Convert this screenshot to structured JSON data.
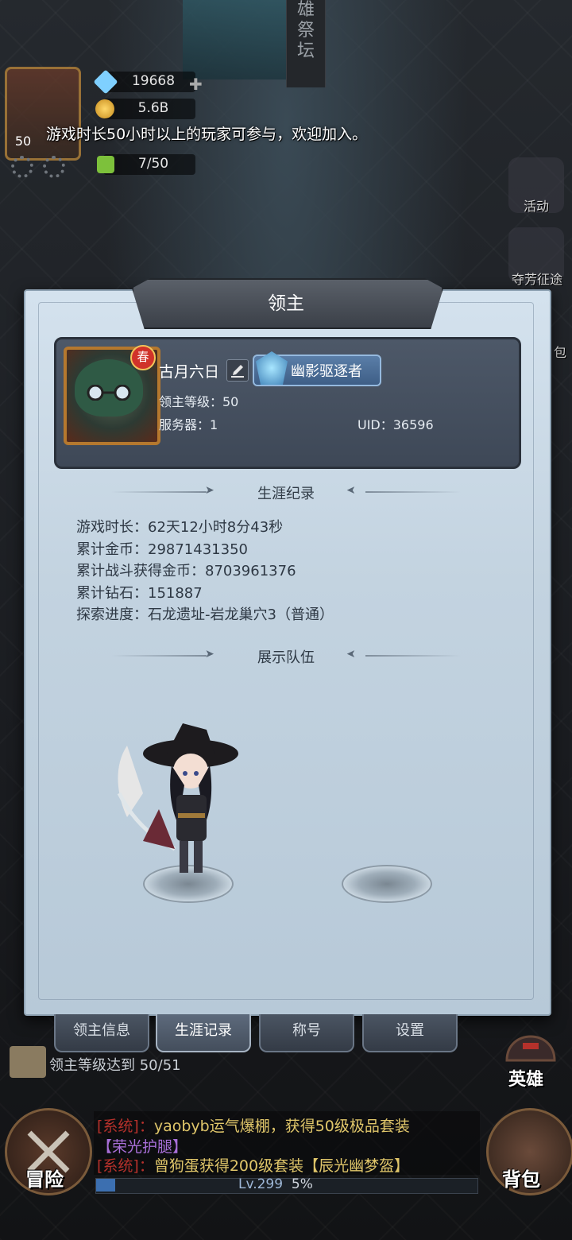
{
  "background": {
    "pillar_text": "雄\n祭\n坛"
  },
  "hud": {
    "level": "50",
    "gems": "19668",
    "gold": "5.6B",
    "stamina": "7/50",
    "avatar_tag": "春"
  },
  "notice": "游戏时长50小时以上的玩家可参与，欢迎加入。",
  "side_menu": {
    "events": "活动",
    "contest": "夺芳征途",
    "bag_partial": "包",
    "hero": "英雄"
  },
  "panel": {
    "title": "领主",
    "profile": {
      "name": "古月六日",
      "title_badge": "幽影驱逐者",
      "level_label": "领主等级：50",
      "server_label": "服务器：1",
      "uid_label": "UID：36596"
    },
    "career_header": "生涯纪录",
    "stats": [
      "游戏时长：62天12小时8分43秒",
      "累计金币：29871431350",
      "累计战斗获得金币：8703961376",
      "累计钻石：151887",
      "探索进度：石龙遗址-岩龙巢穴3（普通）"
    ],
    "team_header": "展示队伍"
  },
  "tabs": [
    {
      "label": "领主信息",
      "active": false
    },
    {
      "label": "生涯记录",
      "active": true
    },
    {
      "label": "称号",
      "active": false
    },
    {
      "label": "设置",
      "active": false
    }
  ],
  "progress_text": "领主等级达到 50/51",
  "chat": {
    "line1": {
      "tag": "[系统]：",
      "user": "yaobyb",
      "text": "运气爆棚，获得50级极品套装"
    },
    "line2_item": "【荣光护腿】",
    "line3": {
      "tag": "[系统]：",
      "user": "曾狗蛋",
      "text": "获得200级套装",
      "item": "【辰光幽梦盔】"
    }
  },
  "bottom_nav": {
    "adventure": "冒险",
    "bag": "背包",
    "xp_label": "Lv.299",
    "xp_percent": "5%",
    "xp_fraction": 0.05
  },
  "colors": {
    "panel_bg": "#c3d3e0",
    "card_bg": "#4d5868",
    "system_red": "#b5312b",
    "gold_text": "#e0c66a",
    "purple_item": "#a86fd8"
  }
}
